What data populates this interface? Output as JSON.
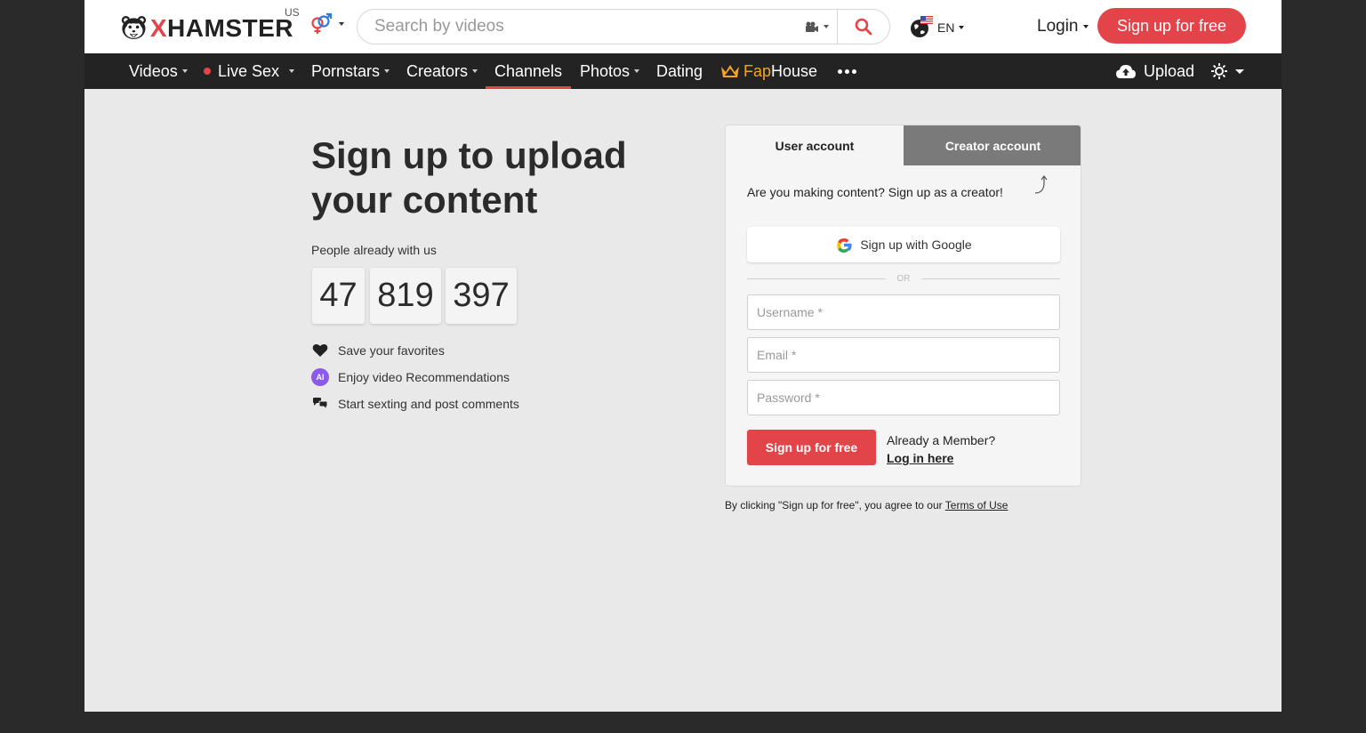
{
  "header": {
    "logo_text_x": "X",
    "logo_text_rest": "HAMSTER",
    "region": "US",
    "search_placeholder": "Search by videos",
    "language": "EN",
    "login_label": "Login",
    "signup_label": "Sign up for free"
  },
  "nav": {
    "items": [
      {
        "label": "Videos"
      },
      {
        "label": "Live Sex"
      },
      {
        "label": "Pornstars"
      },
      {
        "label": "Creators"
      },
      {
        "label": "Channels"
      },
      {
        "label": "Photos"
      },
      {
        "label": "Dating"
      }
    ],
    "faphouse_a": "Fap",
    "faphouse_b": "House",
    "upload_label": "Upload",
    "active": "Channels"
  },
  "main": {
    "title": "Sign up to upload your content",
    "people_label": "People already with us",
    "counter": [
      "47",
      "819",
      "397"
    ],
    "features": [
      {
        "icon": "heart-icon",
        "label": "Save your favorites"
      },
      {
        "icon": "ai-icon",
        "label": "Enjoy video Recommendations",
        "badge": "AI"
      },
      {
        "icon": "chat-icon",
        "label": "Start sexting and post comments"
      }
    ]
  },
  "form": {
    "tab_user": "User account",
    "tab_creator": "Creator account",
    "creator_note": "Are you making content? Sign up as a creator!",
    "google_label": "Sign up with Google",
    "or_label": "OR",
    "username_placeholder": "Username *",
    "email_placeholder": "Email *",
    "password_placeholder": "Password *",
    "submit_label": "Sign up for free",
    "member_text": "Already a Member?",
    "login_link": "Log in here"
  },
  "terms": {
    "text": "By clicking \"Sign up for free\", you agree to our",
    "link": "Terms of Use"
  },
  "colors": {
    "accent": "#e34449",
    "nav_bg": "#232323",
    "page_bg": "#e9e9e9",
    "fap_gold": "#f4a424",
    "ai_purple": "#8c5ae8"
  }
}
